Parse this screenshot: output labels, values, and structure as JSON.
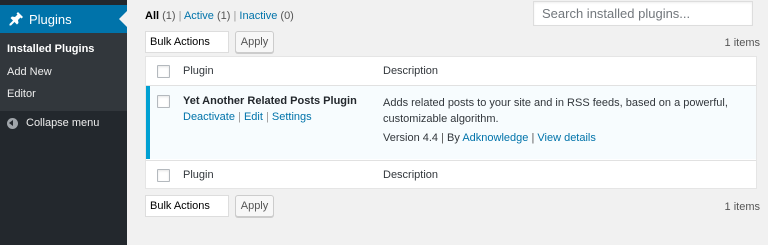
{
  "sidebar": {
    "menu_label": "Plugins",
    "menu_icon": "plugin-icon",
    "items": [
      "Installed Plugins",
      "Add New",
      "Editor"
    ],
    "collapse_label": "Collapse menu"
  },
  "filters": {
    "all": "All",
    "all_count": "(1)",
    "active": "Active",
    "active_count": "(1)",
    "inactive": "Inactive",
    "inactive_count": "(0)",
    "separator": "|"
  },
  "search": {
    "placeholder": "Search installed plugins..."
  },
  "bulk": {
    "label": "Bulk Actions",
    "apply": "Apply",
    "count": "1 items"
  },
  "table": {
    "col_plugin": "Plugin",
    "col_description": "Description",
    "plugin": {
      "name": "Yet Another Related Posts Plugin",
      "deactivate": "Deactivate",
      "edit": "Edit",
      "settings": "Settings",
      "action_sep": "|",
      "description": "Adds related posts to your site and in RSS feeds, based on a powerful, customizable algorithm.",
      "version": "Version 4.4",
      "by": "By",
      "author": "Adknowledge",
      "view_details": "View details",
      "meta_sep": "|"
    }
  },
  "colors": {
    "sidebar_bg": "#23282d",
    "submenu_bg": "#32373c",
    "accent": "#0073aa",
    "active_row_border": "#00a0d2"
  }
}
